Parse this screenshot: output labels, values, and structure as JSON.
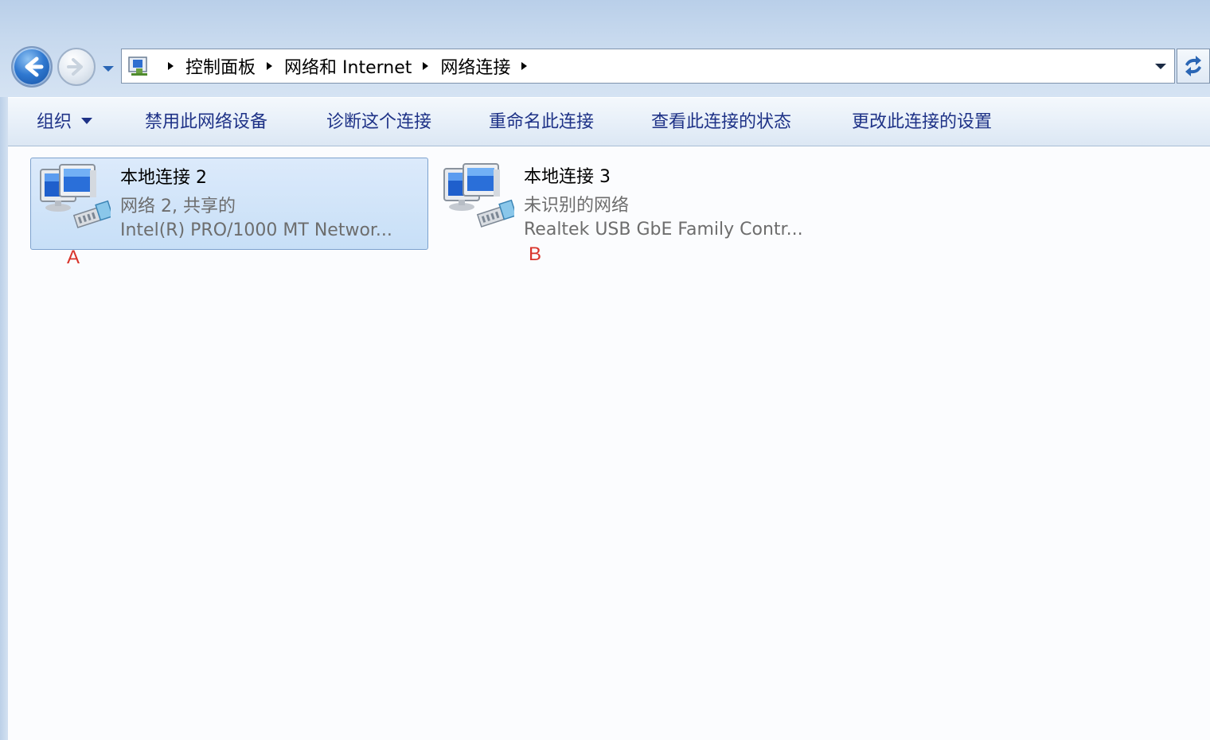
{
  "nav": {
    "back_icon": "back-arrow-icon",
    "forward_icon": "forward-arrow-icon",
    "history_icon": "chevron-down-icon"
  },
  "address": {
    "location_icon": "network-folder-icon",
    "breadcrumbs": [
      "控制面板",
      "网络和 Internet",
      "网络连接"
    ],
    "dropdown_icon": "chevron-down-icon",
    "refresh_icon": "refresh-icon"
  },
  "toolbar": {
    "organize": "组织",
    "disable": "禁用此网络设备",
    "diagnose": "诊断这个连接",
    "rename": "重命名此连接",
    "view_status": "查看此连接的状态",
    "change_settings": "更改此连接的设置"
  },
  "connections": [
    {
      "name": "本地连接 2",
      "network": "网络  2, 共享的",
      "device": "Intel(R) PRO/1000 MT Networ...",
      "selected": true,
      "marker": "A"
    },
    {
      "name": "本地连接 3",
      "network": "未识别的网络",
      "device": "Realtek USB GbE Family Contr...",
      "selected": false,
      "marker": "B"
    }
  ],
  "colors": {
    "toolbar_text": "#1e3287",
    "marker": "#d9342b",
    "selection": "#c7dff7"
  }
}
